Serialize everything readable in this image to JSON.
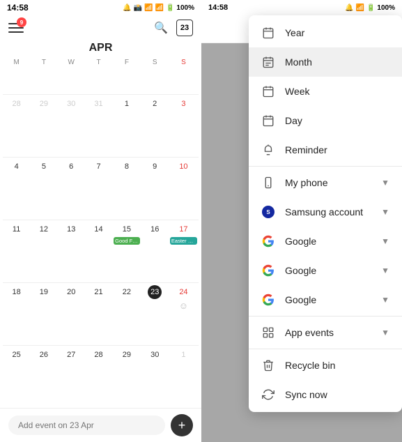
{
  "left": {
    "status_time": "14:58",
    "month_title": "APR",
    "day_headers": [
      "M",
      "W",
      "T",
      "F",
      "S",
      "S"
    ],
    "add_event_placeholder": "Add event on 23 Apr",
    "today_date": 23,
    "search_icon": "🔍",
    "plus_icon": "+"
  },
  "right": {
    "status_time": "14:58",
    "menu_items": [
      {
        "id": "year",
        "label": "Year",
        "icon": "calendar",
        "has_chevron": false,
        "active": false
      },
      {
        "id": "month",
        "label": "Month",
        "icon": "calendar-month",
        "has_chevron": false,
        "active": true
      },
      {
        "id": "week",
        "label": "Week",
        "icon": "calendar-week",
        "has_chevron": false,
        "active": false
      },
      {
        "id": "day",
        "label": "Day",
        "icon": "calendar-day",
        "has_chevron": false,
        "active": false
      },
      {
        "id": "reminder",
        "label": "Reminder",
        "icon": "bell",
        "has_chevron": false,
        "active": false
      },
      {
        "id": "divider1",
        "label": "",
        "icon": "",
        "divider": true
      },
      {
        "id": "myphone",
        "label": "My phone",
        "icon": "phone",
        "has_chevron": true,
        "active": false
      },
      {
        "id": "samsung",
        "label": "Samsung account",
        "icon": "samsung",
        "has_chevron": true,
        "active": false
      },
      {
        "id": "google1",
        "label": "Google",
        "icon": "google",
        "has_chevron": true,
        "active": false
      },
      {
        "id": "google2",
        "label": "Google",
        "icon": "google",
        "has_chevron": true,
        "active": false
      },
      {
        "id": "google3",
        "label": "Google",
        "icon": "google",
        "has_chevron": true,
        "active": false
      },
      {
        "id": "divider2",
        "label": "",
        "icon": "",
        "divider": true
      },
      {
        "id": "appevents",
        "label": "App events",
        "icon": "apps",
        "has_chevron": true,
        "active": false
      },
      {
        "id": "divider3",
        "label": "",
        "icon": "",
        "divider": true
      },
      {
        "id": "recycle",
        "label": "Recycle bin",
        "icon": "trash",
        "has_chevron": false,
        "active": false
      },
      {
        "id": "syncnow",
        "label": "Sync now",
        "icon": "sync",
        "has_chevron": false,
        "active": false
      }
    ]
  },
  "calendar": {
    "weeks": [
      [
        {
          "num": "28",
          "type": "other"
        },
        {
          "num": "",
          "type": "empty"
        },
        {
          "num": "30",
          "type": "other"
        },
        {
          "num": "31",
          "type": "other"
        },
        {
          "num": "1",
          "type": "normal"
        },
        {
          "num": "2",
          "type": "normal"
        },
        {
          "num": "3",
          "type": "sun red"
        }
      ],
      [
        {
          "num": "4",
          "type": "normal"
        },
        {
          "num": "5",
          "type": "normal"
        },
        {
          "num": "6",
          "type": "normal"
        },
        {
          "num": "7",
          "type": "normal"
        },
        {
          "num": "8",
          "type": "normal"
        },
        {
          "num": "9",
          "type": "normal"
        },
        {
          "num": "10",
          "type": "sun red"
        }
      ],
      [
        {
          "num": "11",
          "type": "normal"
        },
        {
          "num": "12",
          "type": "normal"
        },
        {
          "num": "13",
          "type": "normal"
        },
        {
          "num": "14",
          "type": "normal"
        },
        {
          "num": "15",
          "type": "normal",
          "event": "Good Friday",
          "event_color": "green"
        },
        {
          "num": "16",
          "type": "normal"
        },
        {
          "num": "17",
          "type": "sun red",
          "event": "Easter Day",
          "event_color": "teal"
        }
      ],
      [
        {
          "num": "18",
          "type": "normal"
        },
        {
          "num": "19",
          "type": "normal"
        },
        {
          "num": "20",
          "type": "normal"
        },
        {
          "num": "21",
          "type": "normal"
        },
        {
          "num": "22",
          "type": "normal"
        },
        {
          "num": "23",
          "type": "today"
        },
        {
          "num": "24",
          "type": "sun red",
          "smiley": true
        }
      ],
      [
        {
          "num": "25",
          "type": "normal"
        },
        {
          "num": "26",
          "type": "normal"
        },
        {
          "num": "27",
          "type": "normal"
        },
        {
          "num": "28",
          "type": "normal"
        },
        {
          "num": "29",
          "type": "normal"
        },
        {
          "num": "30",
          "type": "normal"
        },
        {
          "num": "1",
          "type": "other"
        }
      ]
    ]
  }
}
